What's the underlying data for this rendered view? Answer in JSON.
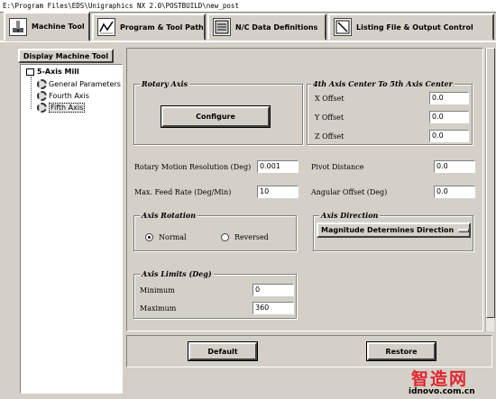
{
  "title_bar": "E:\\Program Files\\EDS\\Unigraphics NX 2.0\\POSTBUILD\\new_post",
  "tabs": [
    {
      "label": "Machine Tool",
      "active": true,
      "icon": "machine-tool-icon"
    },
    {
      "label": "Program & Tool Path",
      "active": false,
      "icon": "program-path-icon"
    },
    {
      "label": "N/C Data Definitions",
      "active": false,
      "icon": "nc-data-icon"
    },
    {
      "label": "Listing File & Output Control",
      "active": false,
      "icon": "listing-file-icon"
    }
  ],
  "left": {
    "display_button": "Display Machine Tool",
    "tree": {
      "root": "5-Axis Mill",
      "items": [
        "General Parameters",
        "Fourth Axis",
        "Fifth Axis"
      ],
      "selected": "Fifth Axis"
    }
  },
  "rotary_axis": {
    "title": "Rotary Axis",
    "configure_button": "Configure"
  },
  "center_offset": {
    "title": "4th Axis Center To 5th Axis Center",
    "x_label": "X Offset",
    "x_value": "0.0",
    "y_label": "Y Offset",
    "y_value": "0.0",
    "z_label": "Z Offset",
    "z_value": "0.0"
  },
  "params": {
    "resolution_label": "Rotary Motion Resolution (Deg)",
    "resolution_value": "0.001",
    "feed_label": "Max. Feed Rate (Deg/Min)",
    "feed_value": "10",
    "pivot_label": "Pivot Distance",
    "pivot_value": "0.0",
    "angular_label": "Angular Offset  (Deg)",
    "angular_value": "0.0"
  },
  "axis_rotation": {
    "title": "Axis Rotation",
    "normal": "Normal",
    "reversed": "Reversed",
    "selected": "Normal"
  },
  "axis_direction": {
    "title": "Axis Direction",
    "value": "Magnitude Determines Direction"
  },
  "axis_limits": {
    "title": "Axis Limits (Deg)",
    "min_label": "Minimum",
    "min_value": "0",
    "max_label": "Maximum",
    "max_value": "360"
  },
  "buttons": {
    "default": "Default",
    "restore": "Restore"
  },
  "watermark": {
    "brand": "智造网",
    "site": "idnovo.com.cn",
    "color": "#e0262e"
  }
}
